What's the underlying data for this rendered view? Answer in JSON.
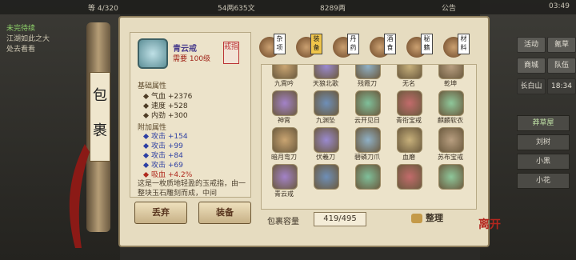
{
  "topbar": {
    "left": "等 4/320",
    "money1": "54两635文",
    "money2": "8289两",
    "notice": "公告",
    "time": "03:49"
  },
  "quest": {
    "title": "未完待续",
    "line1": "江湖如此之大",
    "line2": "处去看看"
  },
  "sidebar": {
    "label1": "包",
    "label2": "裹"
  },
  "item": {
    "name": "青云戒",
    "require": "需要 100级",
    "tag": "戒指"
  },
  "base_title": "基础属性",
  "base_stats": [
    {
      "label": "气血",
      "value": "+2376"
    },
    {
      "label": "速度",
      "value": "+528"
    },
    {
      "label": "内劲",
      "value": "+300"
    }
  ],
  "extra_title": "附加属性",
  "extra_stats": [
    {
      "label": "攻击",
      "value": "+154"
    },
    {
      "label": "攻击",
      "value": "+99"
    },
    {
      "label": "攻击",
      "value": "+84"
    },
    {
      "label": "攻击",
      "value": "+69"
    },
    {
      "label": "吸血",
      "value": "+4.2%"
    }
  ],
  "description": "这是一枚质地轻盈的玉戒指，由一整块玉石雕刻而成，中间",
  "buttons": {
    "discard": "丢弃",
    "equip": "装备",
    "sort": "整理"
  },
  "tabs": [
    {
      "label": "杂项",
      "active": false
    },
    {
      "label": "装备",
      "active": true
    },
    {
      "label": "丹药",
      "active": false
    },
    {
      "label": "酒食",
      "active": false
    },
    {
      "label": "秘籍",
      "active": false
    },
    {
      "label": "材料",
      "active": false
    }
  ],
  "items": [
    "九霄吟",
    "天狼北歌",
    "残霞刀",
    "无名",
    "乾坤",
    "神霄",
    "九渊坠",
    "云开见日",
    "青衔宝戒",
    "麒麟软衣",
    "暗月弯刀",
    "伏羲刀",
    "碧磷刀爪",
    "血磨",
    "苏布宝戒",
    "青云戒",
    "",
    "",
    "",
    ""
  ],
  "capacity": {
    "label": "包裹容量",
    "value": "419/495"
  },
  "right_menu": [
    "活动",
    "氪草",
    "商城",
    "队伍",
    "长白山",
    "18:34"
  ],
  "right_list": [
    "莽草屋",
    "刘树",
    "小黑",
    "小花"
  ],
  "seal": "离开"
}
